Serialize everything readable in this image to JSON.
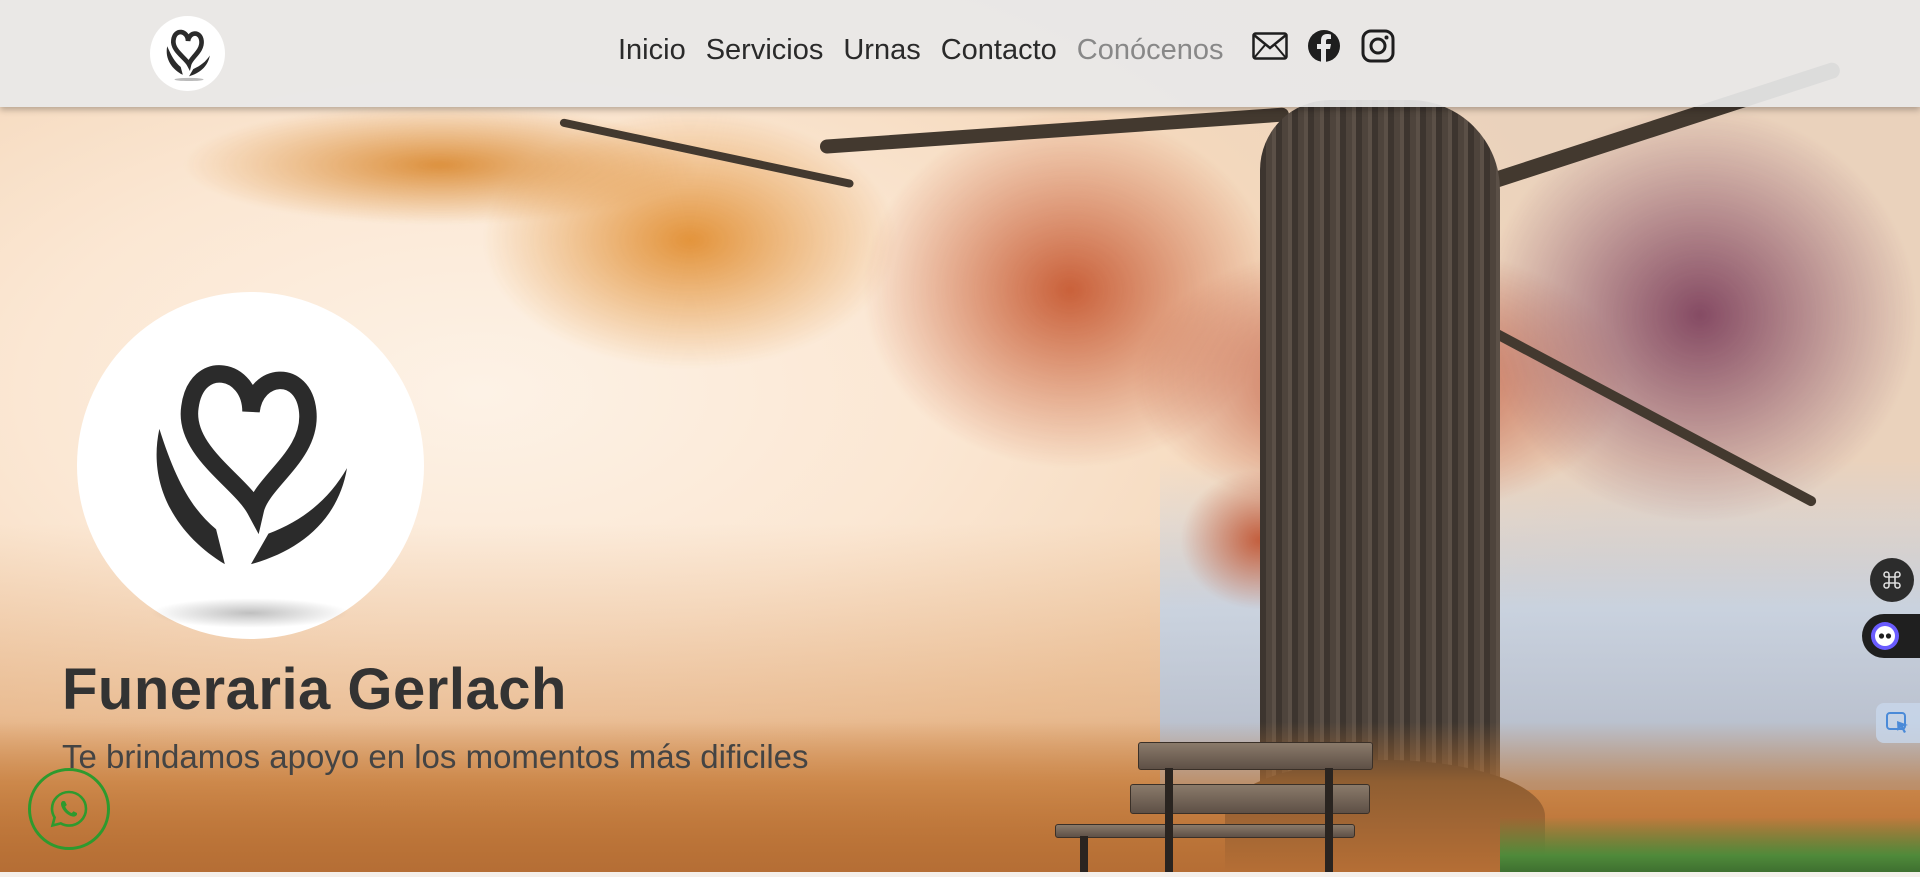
{
  "nav": {
    "links": [
      {
        "label": "Inicio"
      },
      {
        "label": "Servicios"
      },
      {
        "label": "Urnas"
      },
      {
        "label": "Contacto"
      },
      {
        "label": "Conócenos"
      }
    ],
    "active_index": 4,
    "icons": [
      "mail-icon",
      "facebook-icon",
      "instagram-icon"
    ]
  },
  "hero": {
    "title": "Funeraria Gerlach",
    "subtitle": "Te brindamos apoyo en los momentos más dificiles"
  },
  "floating": {
    "whatsapp_icon": "whatsapp-icon",
    "widget_icons": [
      "command-icon",
      "assistant-face-icon",
      "cursor-icon"
    ]
  },
  "colors": {
    "whatsapp": "#2e9a2e",
    "text_dark": "#333333",
    "nav_active": "#888888"
  }
}
